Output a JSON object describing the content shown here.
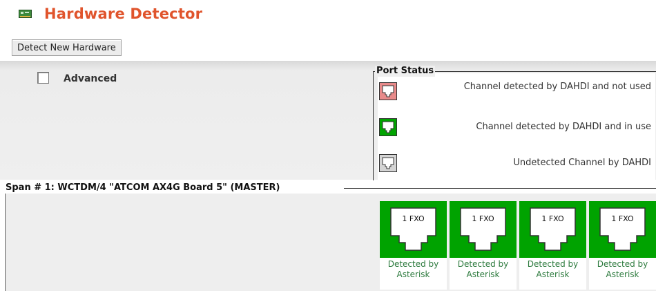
{
  "header": {
    "title": "Hardware Detector",
    "icon": "hardware-card-icon"
  },
  "toolbar": {
    "detect_label": "Detect New Hardware"
  },
  "advanced": {
    "label": "Advanced",
    "checked": false
  },
  "port_status": {
    "legend": "Port Status",
    "items": [
      {
        "text": "Channel detected by DAHDI and not used",
        "color": "#e88a8a",
        "icon": "port-unused-icon"
      },
      {
        "text": "Channel detected by DAHDI and in use",
        "color": "#00a300",
        "icon": "port-in-use-icon"
      },
      {
        "text": "Undetected Channel by DAHDI",
        "color": "#d4d4d4",
        "icon": "port-undetected-icon"
      }
    ]
  },
  "span": {
    "title": "Span # 1: WCTDM/4 \"ATCOM AX4G Board 5\" (MASTER)",
    "ports": [
      {
        "label": "1 FXO",
        "status": "Detected by Asterisk"
      },
      {
        "label": "1 FXO",
        "status": "Detected by Asterisk"
      },
      {
        "label": "1 FXO",
        "status": "Detected by Asterisk"
      },
      {
        "label": "1 FXO",
        "status": "Detected by Asterisk"
      }
    ],
    "port_color": "#00a300"
  }
}
